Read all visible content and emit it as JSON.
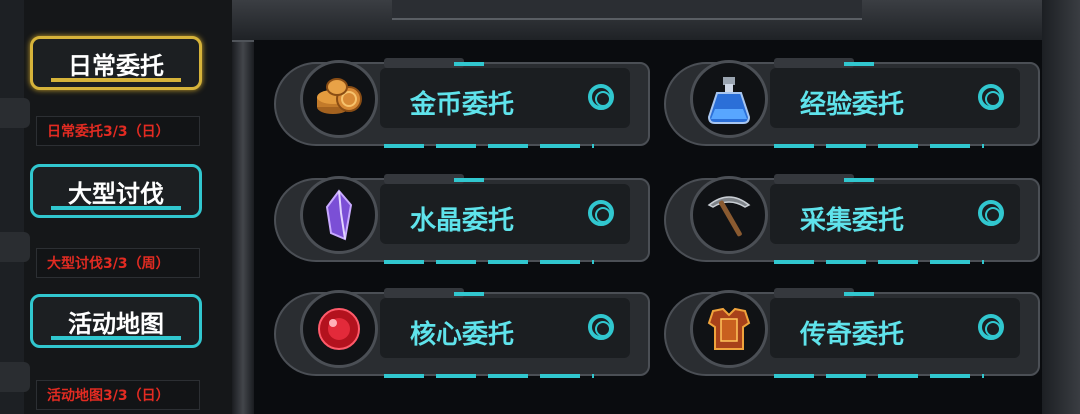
{
  "sidebar": {
    "tabs": [
      {
        "label": "日常委托",
        "sub": "日常委托3/3（日）"
      },
      {
        "label": "大型讨伐",
        "sub": "大型讨伐3/3（周）"
      },
      {
        "label": "活动地图",
        "sub": "活动地图3/3（日）"
      }
    ]
  },
  "cards": [
    {
      "label": "金币委托",
      "icon": "coins-icon"
    },
    {
      "label": "经验委托",
      "icon": "potion-icon"
    },
    {
      "label": "水晶委托",
      "icon": "crystal-icon"
    },
    {
      "label": "采集委托",
      "icon": "pickaxe-icon"
    },
    {
      "label": "核心委托",
      "icon": "core-orb-icon"
    },
    {
      "label": "传奇委托",
      "icon": "armor-icon"
    }
  ],
  "colors": {
    "accent": "#31c7cf",
    "gold": "#d6b33a",
    "red": "#e22b22"
  }
}
